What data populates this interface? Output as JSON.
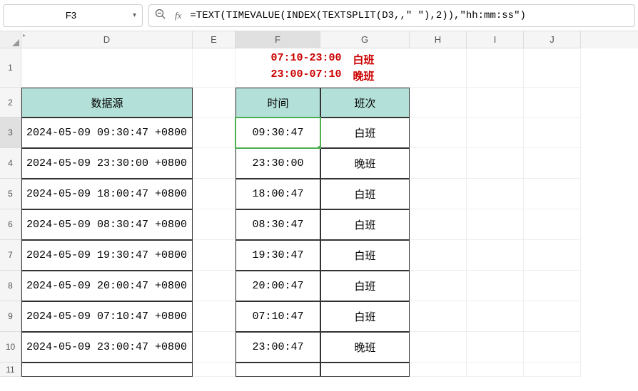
{
  "namebox": "F3",
  "formula": "=TEXT(TIMEVALUE(INDEX(TEXTSPLIT(D3,,\" \"),2)),\"hh:mm:ss\")",
  "columns": [
    "D",
    "E",
    "F",
    "G",
    "H",
    "I",
    "J"
  ],
  "row_numbers": [
    "1",
    "2",
    "3",
    "4",
    "5",
    "6",
    "7",
    "8",
    "9",
    "10",
    "11"
  ],
  "legend": {
    "line1_time": "07:10-23:00",
    "line1_shift": "白班",
    "line2_time": "23:00-07:10",
    "line2_shift": "晚班"
  },
  "headers": {
    "source": "数据源",
    "time": "时间",
    "shift": "班次"
  },
  "rows": [
    {
      "source": "2024-05-09 09:30:47 +0800",
      "time": "09:30:47",
      "shift": "白班"
    },
    {
      "source": "2024-05-09 23:30:00 +0800",
      "time": "23:30:00",
      "shift": "晚班"
    },
    {
      "source": "2024-05-09 18:00:47 +0800",
      "time": "18:00:47",
      "shift": "白班"
    },
    {
      "source": "2024-05-09 08:30:47 +0800",
      "time": "08:30:47",
      "shift": "白班"
    },
    {
      "source": "2024-05-09 19:30:47 +0800",
      "time": "19:30:47",
      "shift": "白班"
    },
    {
      "source": "2024-05-09 20:00:47 +0800",
      "time": "20:00:47",
      "shift": "白班"
    },
    {
      "source": "2024-05-09 07:10:47 +0800",
      "time": "07:10:47",
      "shift": "白班"
    },
    {
      "source": "2024-05-09 23:00:47 +0800",
      "time": "23:00:47",
      "shift": "晚班"
    }
  ],
  "chart_data": {
    "type": "table",
    "title": "数据源 / 时间 / 班次",
    "columns": [
      "数据源",
      "时间",
      "班次"
    ],
    "rows": [
      [
        "2024-05-09 09:30:47 +0800",
        "09:30:47",
        "白班"
      ],
      [
        "2024-05-09 23:30:00 +0800",
        "23:30:00",
        "晚班"
      ],
      [
        "2024-05-09 18:00:47 +0800",
        "18:00:47",
        "白班"
      ],
      [
        "2024-05-09 08:30:47 +0800",
        "08:30:47",
        "白班"
      ],
      [
        "2024-05-09 19:30:47 +0800",
        "19:30:47",
        "白班"
      ],
      [
        "2024-05-09 20:00:47 +0800",
        "20:00:47",
        "白班"
      ],
      [
        "2024-05-09 07:10:47 +0800",
        "07:10:47",
        "白班"
      ],
      [
        "2024-05-09 23:00:47 +0800",
        "23:00:47",
        "晚班"
      ]
    ]
  }
}
